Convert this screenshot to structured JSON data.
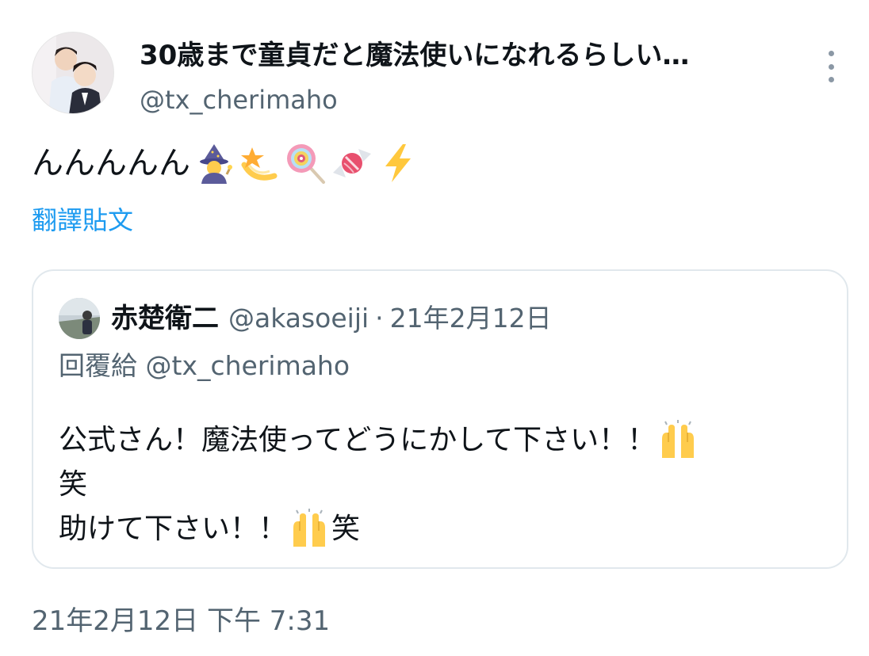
{
  "tweet": {
    "author": {
      "display_name": "30歳まで童貞だと魔法使いになれるらしい…",
      "handle": "@tx_cherimaho",
      "avatar": "profile-photo"
    },
    "more_icon": "more-vertical-icon",
    "text": "んんんんん",
    "emojis": [
      "mage-emoji",
      "dizzy-emoji",
      "lollipop-emoji",
      "candy-emoji",
      "lightning-emoji"
    ],
    "translate_label": "翻譯貼文",
    "timestamp": "21年2月12日 下午 7:31"
  },
  "quote": {
    "author": {
      "display_name": "赤楚衛二",
      "handle": "@akasoeiji",
      "separator": "·",
      "date": "21年2月12日"
    },
    "reply_prefix": "回覆給",
    "reply_to": "@tx_cherimaho",
    "lines": [
      {
        "text": "公式さん！魔法使ってどうにかして下さい！！",
        "emoji": "raising-hands-emoji"
      },
      {
        "text": "笑"
      },
      {
        "text_before": "助けて下さい！！",
        "emoji": "raising-hands-emoji",
        "text_after": "笑"
      }
    ]
  },
  "colors": {
    "primary_text": "#0f1419",
    "secondary_text": "#536471",
    "link": "#1d9bf0",
    "border": "#e1e8ed"
  }
}
